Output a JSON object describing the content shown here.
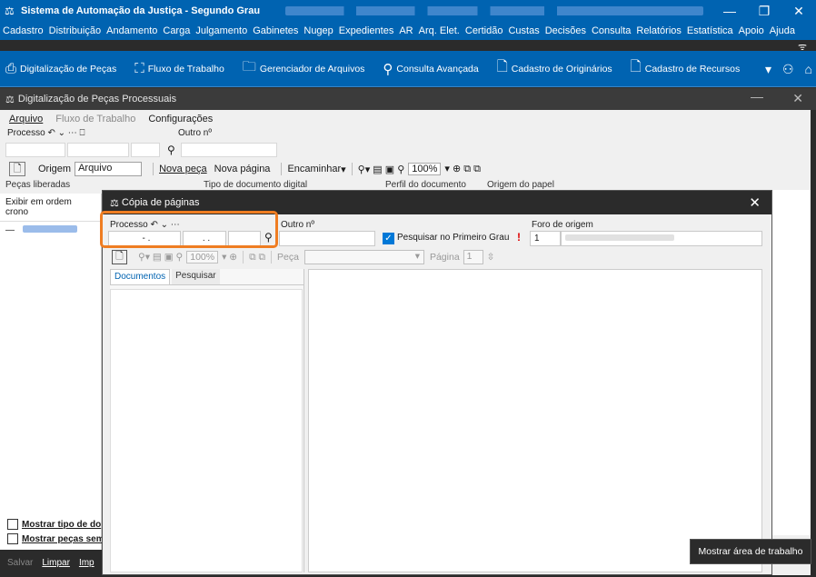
{
  "app": {
    "title": "Sistema de Automação da Justiça - Segundo Grau",
    "window_buttons": [
      "—",
      "❐",
      "✕"
    ]
  },
  "menu": [
    "Cadastro",
    "Distribuição",
    "Andamento",
    "Carga",
    "Julgamento",
    "Gabinetes",
    "Nugep",
    "Expedientes",
    "AR",
    "Arq. Elet.",
    "Certidão",
    "Custas",
    "Decisões",
    "Consulta",
    "Relatórios",
    "Estatística",
    "Apoio",
    "Ajuda"
  ],
  "toolbar": [
    {
      "icon": "scanner-icon",
      "glyph": "⎙",
      "label": "Digitalização de Peças"
    },
    {
      "icon": "workflow-icon",
      "glyph": "⛶",
      "label": "Fluxo de Trabalho"
    },
    {
      "icon": "folder-icon",
      "glyph": "🗀",
      "label": "Gerenciador de Arquivos"
    },
    {
      "icon": "advanced-search-icon",
      "glyph": "⚲",
      "label": "Consulta Avançada"
    },
    {
      "icon": "document-icon",
      "glyph": "🗋",
      "label": "Cadastro de Originários"
    },
    {
      "icon": "resource-icon",
      "glyph": "🗋",
      "label": "Cadastro de Recursos"
    }
  ],
  "inner_window": {
    "title": "Digitalização de Peças Processuais",
    "menu": {
      "arquivo": "Arquivo",
      "fluxo": "Fluxo de Trabalho",
      "config": "Configurações"
    },
    "processo_label": "Processo",
    "outro_label": "Outro nº",
    "origem_label": "Origem",
    "origem_value": "Arquivo",
    "nova_peca": "Nova peça",
    "nova_pagina": "Nova página",
    "encaminhar": "Encaminhar",
    "zoom": "100%",
    "headers": {
      "pecas": "Peças liberadas",
      "tipo": "Tipo de documento digital",
      "perfil": "Perfil do documento",
      "origem_papel": "Origem do papel"
    },
    "exibir": "Exibir em ordem crono",
    "mostrar_tipo": "Mostrar tipo de do",
    "mostrar_pecas": "Mostrar peças sem",
    "bottom": {
      "salvar": "Salvar",
      "limpar": "Limpar",
      "imp": "Imp"
    }
  },
  "dialog": {
    "title": "Cópia de páginas",
    "processo_label": "Processo",
    "outro_label": "Outro nº",
    "foro_label": "Foro de origem",
    "proc_part1": "- .",
    "proc_part2": ". .",
    "pesquisar_primeiro": "Pesquisar no Primeiro Grau",
    "warning": "!",
    "foro_value": "1",
    "zoom": "100%",
    "peca_label": "Peça",
    "pagina_label": "Página",
    "pagina_value": "1",
    "tabs": {
      "documentos": "Documentos",
      "pesquisar": "Pesquisar"
    }
  },
  "tooltip": "Mostrar área de trabalho",
  "colors": {
    "brand": "#0063b1",
    "highlight": "#ef7d22",
    "dark": "#2b2b2b"
  }
}
